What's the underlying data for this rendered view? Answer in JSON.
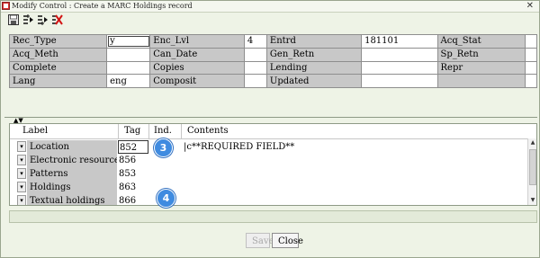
{
  "window": {
    "title": "Modify Control : Create a MARC Holdings record",
    "close_glyph": "✕"
  },
  "toolbar": {
    "icons": [
      "save-record-icon",
      "insert-field-icon",
      "insert-field-after-icon",
      "delete-field-icon"
    ]
  },
  "fixed_fields": {
    "rows": [
      [
        {
          "label": "Rec_Type",
          "value": "y"
        },
        {
          "label": "Enc_Lvl",
          "value": "4"
        },
        {
          "label": "Entrd",
          "value": "181101"
        },
        {
          "label": "Acq_Stat",
          "value": ""
        }
      ],
      [
        {
          "label": "Acq_Meth",
          "value": ""
        },
        {
          "label": "Can_Date",
          "value": ""
        },
        {
          "label": "Gen_Retn",
          "value": ""
        },
        {
          "label": "Sp_Retn",
          "value": ""
        }
      ],
      [
        {
          "label": "Complete",
          "value": ""
        },
        {
          "label": "Copies",
          "value": ""
        },
        {
          "label": "Lending",
          "value": ""
        },
        {
          "label": "Repr",
          "value": ""
        }
      ],
      [
        {
          "label": "Lang",
          "value": "eng"
        },
        {
          "label": "Composit",
          "value": ""
        },
        {
          "label": "Updated",
          "value": ""
        },
        {
          "label": "",
          "value": ""
        }
      ]
    ]
  },
  "variable_fields": {
    "headers": {
      "label": "Label",
      "tag": "Tag",
      "ind": "Ind.",
      "contents": "Contents"
    },
    "rows": [
      {
        "label": "Location",
        "tag": "852",
        "contents": "|c**REQUIRED FIELD**"
      },
      {
        "label": "Electronic resource",
        "tag": "856",
        "contents": ""
      },
      {
        "label": "Patterns",
        "tag": "853",
        "contents": ""
      },
      {
        "label": "Holdings",
        "tag": "863",
        "contents": ""
      },
      {
        "label": "Textual holdings",
        "tag": "866",
        "contents": ""
      }
    ]
  },
  "callouts": [
    "3",
    "4"
  ],
  "buttons": {
    "save": "Save",
    "close": "Close"
  },
  "colors": {
    "background": "#eef3e6",
    "label_cell": "#c8c8c8",
    "callout": "#3f8be0"
  }
}
